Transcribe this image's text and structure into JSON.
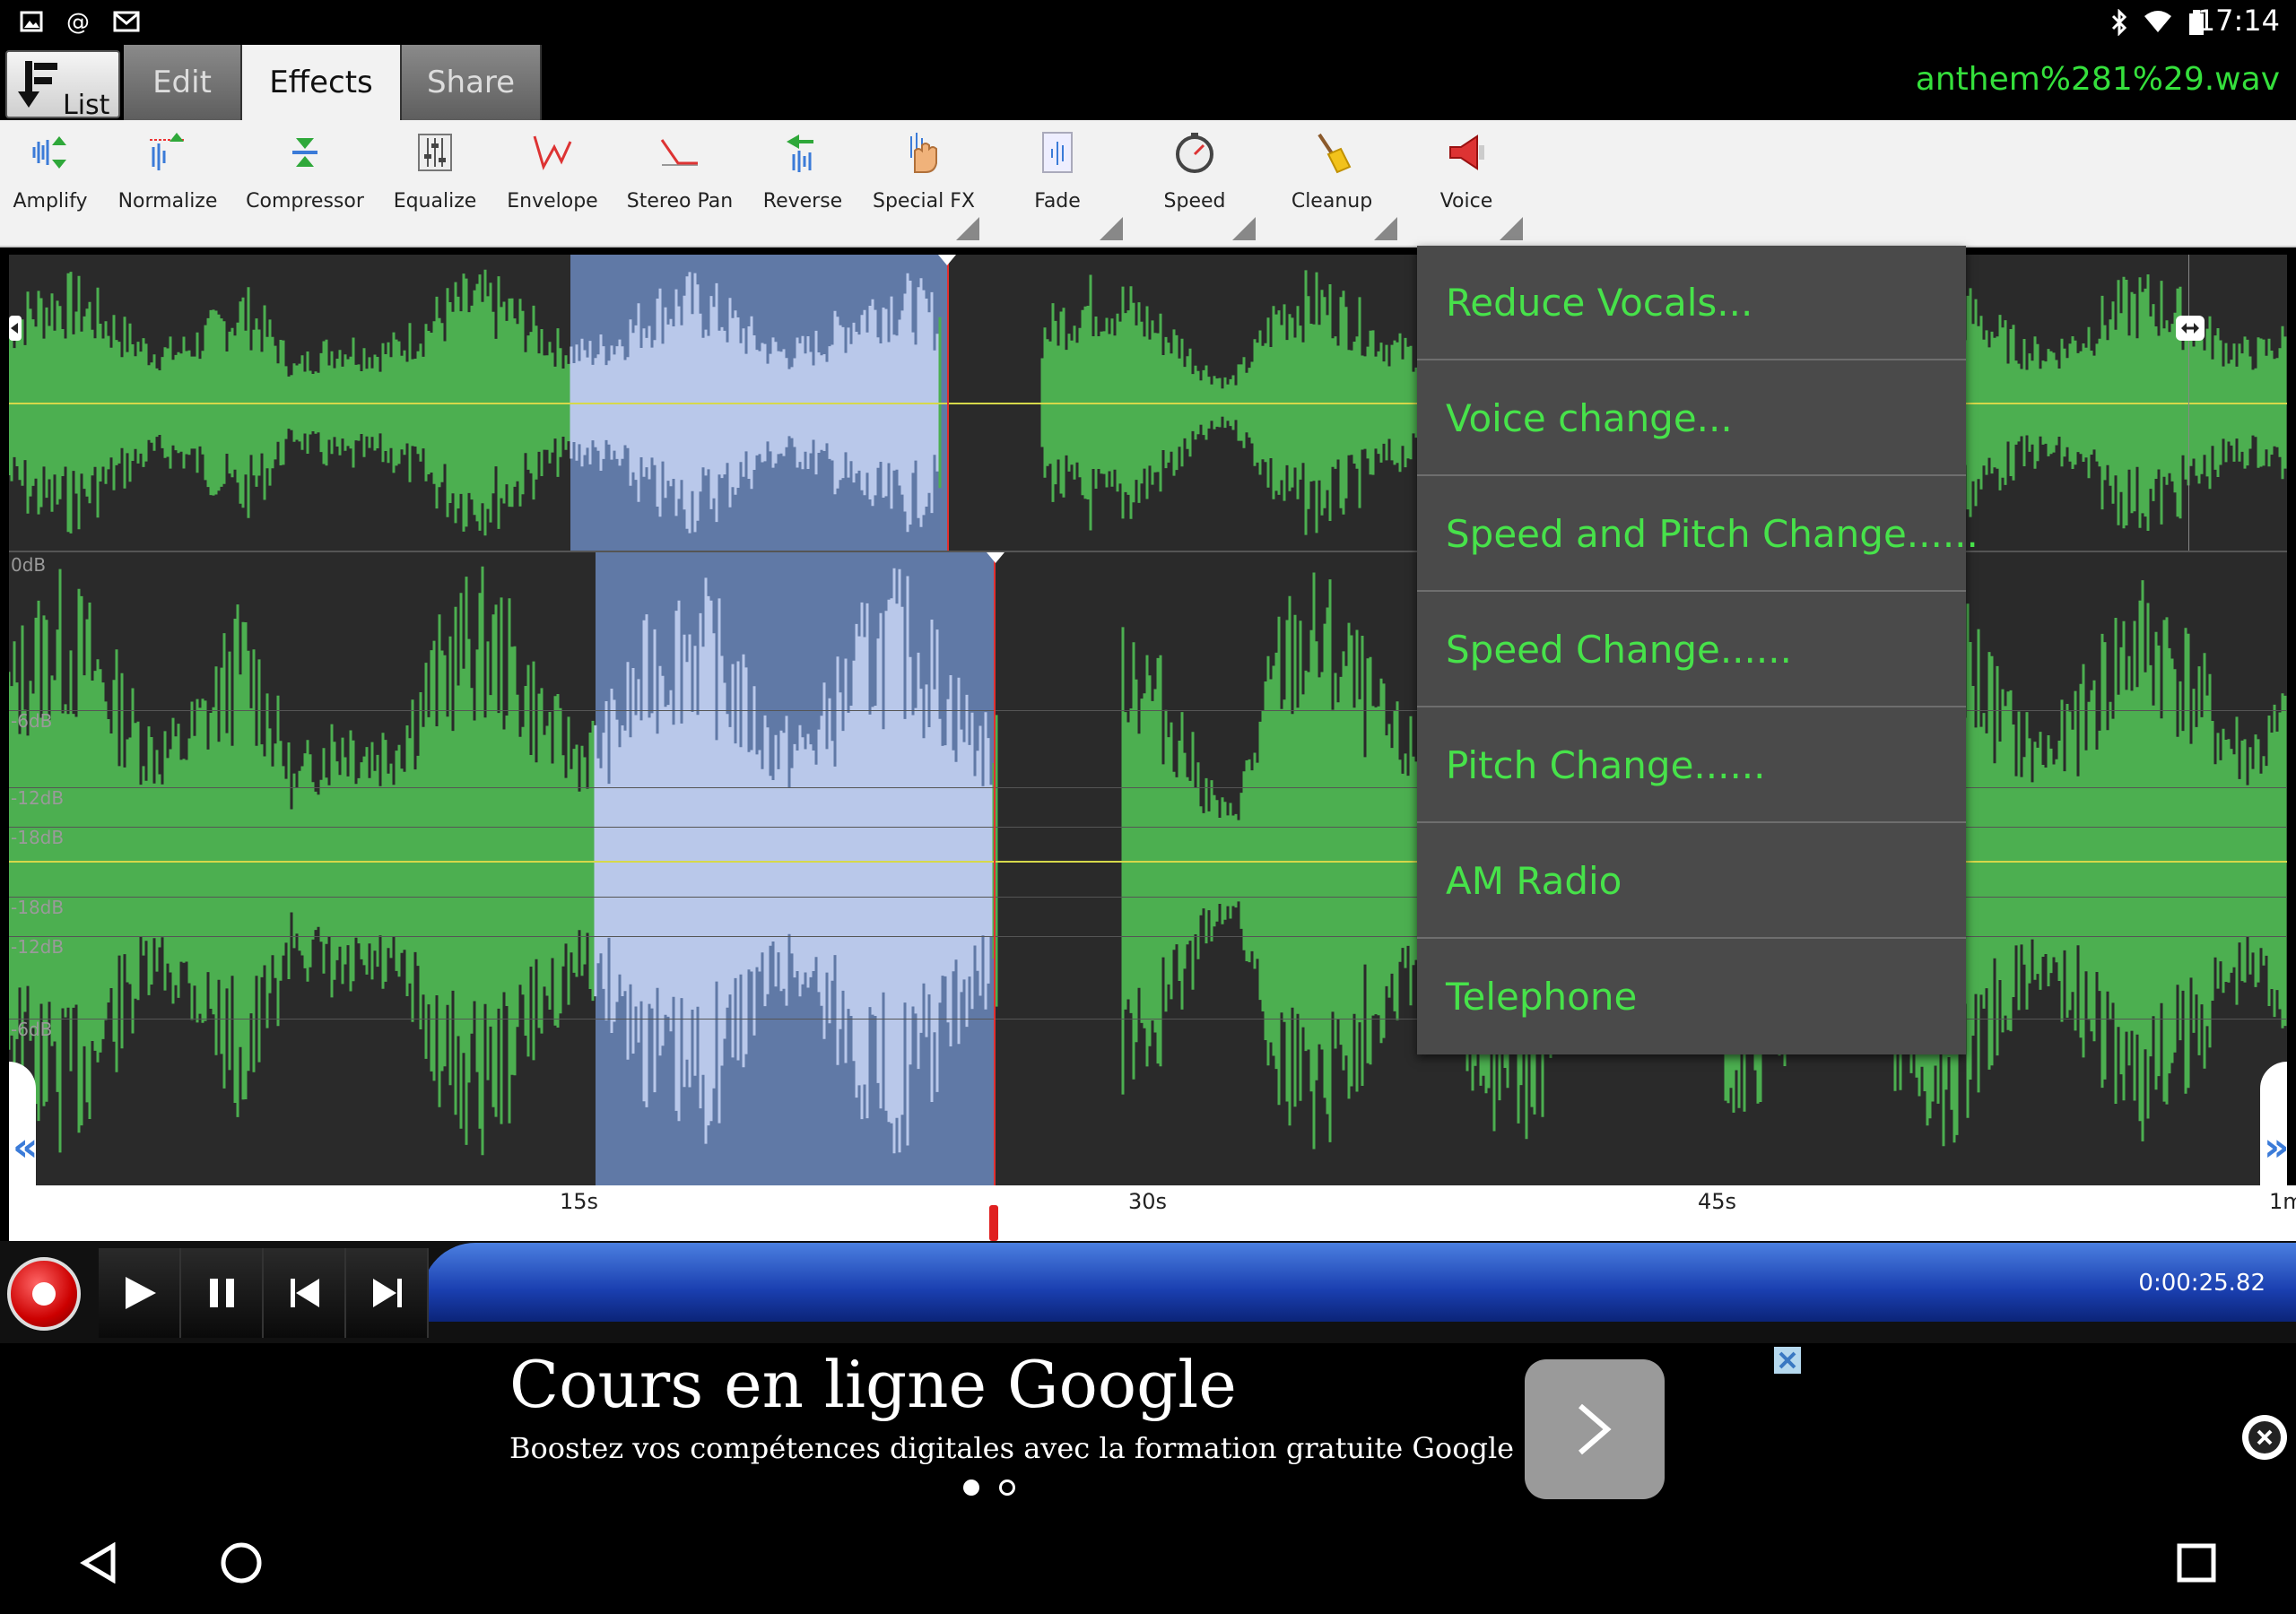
{
  "status_bar": {
    "time": "17:14"
  },
  "tabs": {
    "list_label": "List",
    "items": [
      {
        "label": "Edit"
      },
      {
        "label": "Effects"
      },
      {
        "label": "Share"
      }
    ]
  },
  "file": {
    "name": "anthem%281%29.wav"
  },
  "toolbar": {
    "items": [
      {
        "label": "Amplify",
        "icon": "amplify-icon"
      },
      {
        "label": "Normalize",
        "icon": "normalize-icon"
      },
      {
        "label": "Compressor",
        "icon": "compressor-icon"
      },
      {
        "label": "Equalize",
        "icon": "equalize-icon"
      },
      {
        "label": "Envelope",
        "icon": "envelope-icon"
      },
      {
        "label": "Stereo Pan",
        "icon": "stereo-pan-icon"
      },
      {
        "label": "Reverse",
        "icon": "reverse-icon"
      },
      {
        "label": "Special FX",
        "icon": "special-fx-icon"
      },
      {
        "label": "Fade",
        "icon": "fade-icon"
      },
      {
        "label": "Speed",
        "icon": "speed-icon"
      },
      {
        "label": "Cleanup",
        "icon": "cleanup-icon"
      },
      {
        "label": "Voice",
        "icon": "voice-icon"
      }
    ]
  },
  "waveform": {
    "db_labels": [
      "0dB",
      "-6dB",
      "-12dB",
      "-18dB",
      "-18dB",
      "-12dB",
      "-6dB"
    ],
    "colors": {
      "wave": "#4caf50",
      "selection": "#6079a6",
      "selection_wave": "#b9c8ea",
      "background": "#2a2a2a"
    }
  },
  "timeline": {
    "ticks": [
      "15s",
      "30s",
      "45s",
      "1m"
    ]
  },
  "transport": {
    "time": "0:00:25.82"
  },
  "ad": {
    "title": "Cours en ligne Google",
    "subtitle": "Boostez vos compétences digitales avec la formation gratuite Google"
  },
  "voice_menu": {
    "items": [
      {
        "label": "Reduce Vocals..."
      },
      {
        "label": "Voice change..."
      },
      {
        "label": "Speed and Pitch Change......"
      },
      {
        "label": "Speed Change......"
      },
      {
        "label": "Pitch Change......"
      },
      {
        "label": "AM Radio"
      },
      {
        "label": "Telephone"
      }
    ]
  }
}
